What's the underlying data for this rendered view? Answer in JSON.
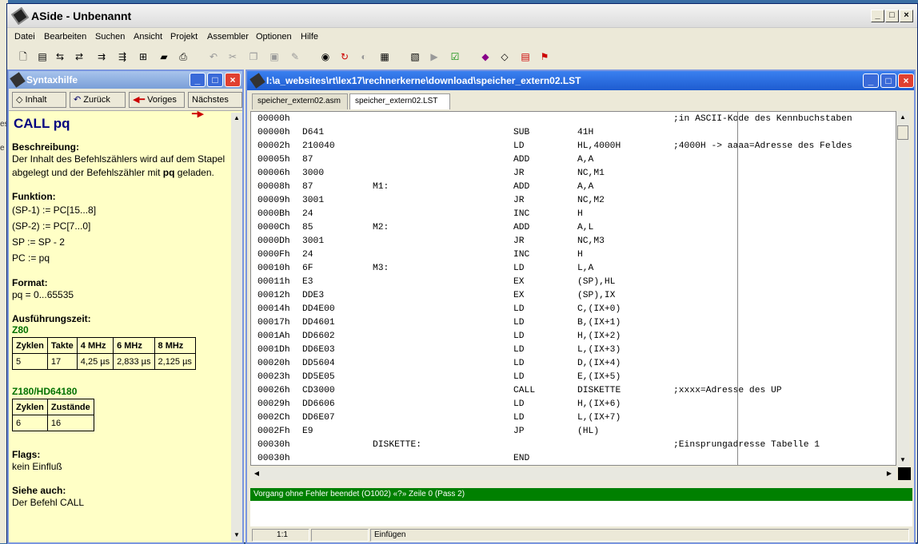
{
  "app": {
    "title": "ASide - Unbenannt"
  },
  "menu": [
    "Datei",
    "Bearbeiten",
    "Suchen",
    "Ansicht",
    "Projekt",
    "Assembler",
    "Optionen",
    "Hilfe"
  ],
  "syntax": {
    "title": "Syntaxhilfe",
    "nav": {
      "inhalt": "Inhalt",
      "zurueck": "Zurück",
      "voriges": "Voriges",
      "naechstes": "Nächstes"
    },
    "heading": "CALL pq",
    "beschreibung_label": "Beschreibung",
    "beschreibung_pre": "Der Inhalt des Befehlszählers wird auf dem Stapel abgelegt und der Befehlszähler mit ",
    "beschreibung_bold": "pq",
    "beschreibung_post": " geladen.",
    "funktion_label": "Funktion",
    "funktion": [
      "(SP-1) := PC[15...8]",
      "(SP-2) := PC[7...0]",
      "SP := SP - 2",
      "PC := pq"
    ],
    "format_label": "Format",
    "format": "pq = 0...65535",
    "zeit_label": "Ausführungszeit:",
    "z80": "Z80",
    "z80_table": [
      [
        "Zyklen",
        "Takte",
        "4 MHz",
        "6 MHz",
        "8 MHz"
      ],
      [
        "5",
        "17",
        "4,25 µs",
        "2,833 µs",
        "2,125 µs"
      ]
    ],
    "z180": "Z180/HD64180",
    "z180_table": [
      [
        "Zyklen",
        "Zustände"
      ],
      [
        "6",
        "16"
      ]
    ],
    "flags_label": "Flags",
    "flags": "kein Einfluß",
    "siehe_label": "Siehe auch",
    "siehe": "Der Befehl CALL"
  },
  "editor": {
    "title": "I:\\a_websites\\rt\\lex17\\rechnerkerne\\download\\speicher_extern02.LST",
    "tabs": [
      "speicher_extern02.asm",
      "speicher_extern02.LST"
    ],
    "lines": [
      [
        "00000h",
        "",
        "",
        "",
        "",
        ";in ASCII-Kode des Kennbuchstaben"
      ],
      [
        "00000h",
        "D641",
        "",
        "SUB",
        "41H",
        ""
      ],
      [
        "00002h",
        "210040",
        "",
        "LD",
        "HL,4000H",
        ";4000H -> aaaa=Adresse des Feldes"
      ],
      [
        "00005h",
        "87",
        "",
        "ADD",
        "A,A",
        ""
      ],
      [
        "00006h",
        "3000",
        "",
        "JR",
        "NC,M1",
        ""
      ],
      [
        "00008h",
        "87",
        "M1:",
        "ADD",
        "A,A",
        ""
      ],
      [
        "00009h",
        "3001",
        "",
        "JR",
        "NC,M2",
        ""
      ],
      [
        "0000Bh",
        "24",
        "",
        "INC",
        "H",
        ""
      ],
      [
        "0000Ch",
        "85",
        "M2:",
        "ADD",
        "A,L",
        ""
      ],
      [
        "0000Dh",
        "3001",
        "",
        "JR",
        "NC,M3",
        ""
      ],
      [
        "0000Fh",
        "24",
        "",
        "INC",
        "H",
        ""
      ],
      [
        "00010h",
        "6F",
        "M3:",
        "LD",
        "L,A",
        ""
      ],
      [
        "00011h",
        "E3",
        "",
        "EX",
        "(SP),HL",
        ""
      ],
      [
        "00012h",
        "DDE3",
        "",
        "EX",
        "(SP),IX",
        ""
      ],
      [
        "00014h",
        "DD4E00",
        "",
        "LD",
        "C,(IX+0)",
        ""
      ],
      [
        "00017h",
        "DD4601",
        "",
        "LD",
        "B,(IX+1)",
        ""
      ],
      [
        "0001Ah",
        "DD6602",
        "",
        "LD",
        "H,(IX+2)",
        ""
      ],
      [
        "0001Dh",
        "DD6E03",
        "",
        "LD",
        "L,(IX+3)",
        ""
      ],
      [
        "00020h",
        "DD5604",
        "",
        "LD",
        "D,(IX+4)",
        ""
      ],
      [
        "00023h",
        "DD5E05",
        "",
        "LD",
        "E,(IX+5)",
        ""
      ],
      [
        "00026h",
        "CD3000",
        "",
        "CALL",
        "DISKETTE",
        ";xxxx=Adresse des UP"
      ],
      [
        "00029h",
        "DD6606",
        "",
        "LD",
        "H,(IX+6)",
        ""
      ],
      [
        "0002Ch",
        "DD6E07",
        "",
        "LD",
        "L,(IX+7)",
        ""
      ],
      [
        "0002Fh",
        "E9",
        "",
        "JP",
        "(HL)",
        ""
      ],
      [
        "00030h",
        "",
        "DISKETTE:",
        "",
        "",
        ";Einsprungadresse Tabelle 1"
      ],
      [
        "00030h",
        "",
        "",
        "END",
        "",
        ""
      ]
    ],
    "message": "Vorgang ohne Fehler beendet (O1002) «?» Zeile 0 (Pass 2)",
    "status": {
      "pos": "1:1",
      "mode": "Einfügen"
    }
  },
  "colors": {
    "accent": "#1e5cd0",
    "help_bg": "#ffffc6",
    "ok_bar": "#008000"
  }
}
